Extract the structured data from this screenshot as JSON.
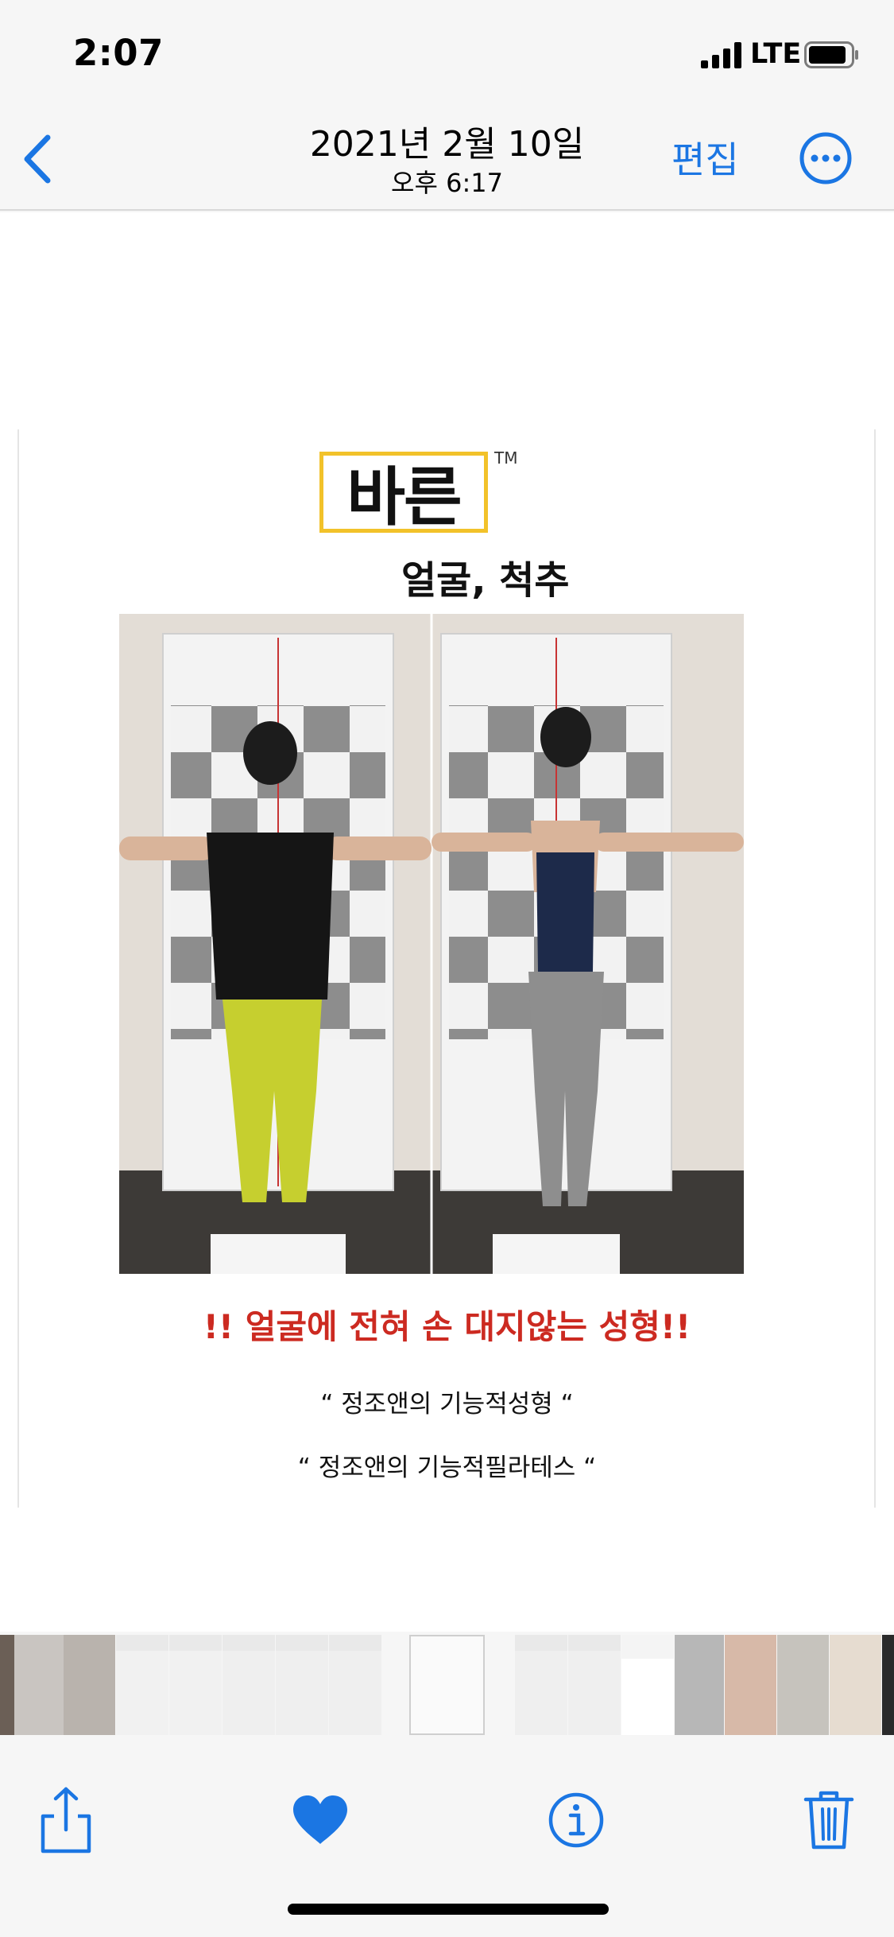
{
  "status_bar": {
    "time": "2:07",
    "network": "LTE"
  },
  "nav": {
    "title": "2021년 2월 10일",
    "subtitle": "오후 6:17",
    "edit_label": "편집"
  },
  "photo": {
    "logo_text": "바른",
    "logo_tm": "TM",
    "logo_subtitle": "얼굴, 척추",
    "headline": "!! 얼굴에 전혀 손 대지않는 성형!!",
    "quote1": "“ 정조앤의 기능적성형 “",
    "quote2": "“ 정조앤의 기능적필라테스 “"
  },
  "colors": {
    "accent": "#1b76e3",
    "headline_red": "#cc2a21",
    "logo_yellow": "#f2c22a"
  },
  "toolbar": {
    "icons": [
      "share-icon",
      "heart-icon",
      "info-icon",
      "trash-icon"
    ]
  }
}
